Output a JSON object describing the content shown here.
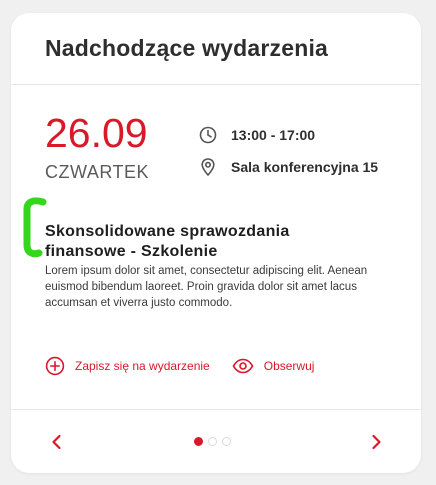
{
  "colors": {
    "accent": "#d9182a",
    "text": "#2e2e2e",
    "marker": "#36d61f"
  },
  "card": {
    "title": "Nadchodzące wydarzenia"
  },
  "event": {
    "date": "26.09",
    "weekday": "CZWARTEK",
    "time": "13:00 - 17:00",
    "location": "Sala konferencyjna 15",
    "title_line1": "Skonsolidowane sprawozdania",
    "title_line2": "finansowe - Szkolenie",
    "description": "Lorem ipsum dolor sit amet, consectetur adipiscing elit. Aenean euismod bibendum laoreet. Proin gravida dolor sit amet lacus accumsan et viverra justo commodo."
  },
  "icons": {
    "time": "clock-icon",
    "location": "map-pin-icon",
    "register": "plus-circle-icon",
    "follow": "eye-icon",
    "prev": "chevron-left-icon",
    "next": "chevron-right-icon"
  },
  "actions": {
    "register_label": "Zapisz się na wydarzenie",
    "follow_label": "Obserwuj"
  },
  "pagination": {
    "total": 3,
    "current": 1
  }
}
